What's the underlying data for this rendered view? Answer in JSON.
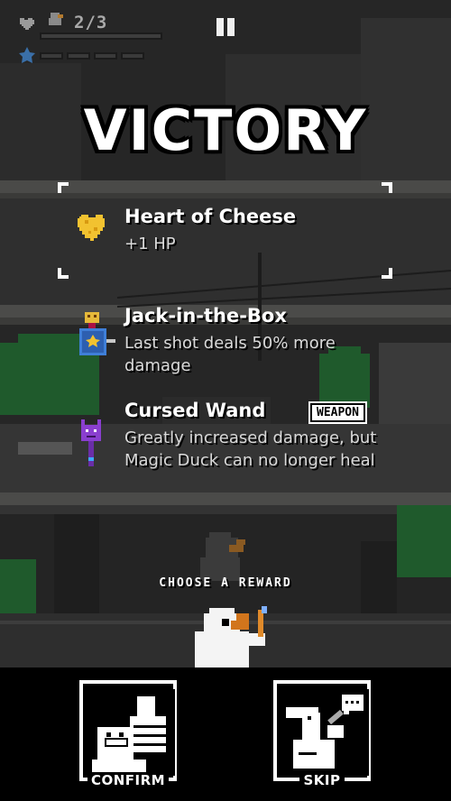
{
  "hud": {
    "hp_count": "2/3",
    "heart_icon": "heart-icon",
    "star_icon": "star-icon",
    "pause_icon": "pause-icon"
  },
  "title": "VICTORY",
  "rewards": [
    {
      "name": "Heart of Cheese",
      "desc": "+1 HP",
      "icon": "cheese-heart-icon",
      "badge": ""
    },
    {
      "name": "Jack-in-the-Box",
      "desc": "Last shot deals 50% more damage",
      "icon": "jack-in-the-box-icon",
      "badge": ""
    },
    {
      "name": "Cursed Wand",
      "desc": "Greatly increased damage, but Magic Duck can no longer heal",
      "icon": "cursed-wand-icon",
      "badge": "WEAPON"
    }
  ],
  "prompt": "CHOOSE A REWARD",
  "controls": {
    "confirm_label": "CONFIRM",
    "skip_label": "SKIP"
  },
  "colors": {
    "cheese": "#f2c230",
    "wand": "#8a3fcf",
    "jack_box": "#3f7fd8",
    "tree": "#1f5a2c"
  }
}
